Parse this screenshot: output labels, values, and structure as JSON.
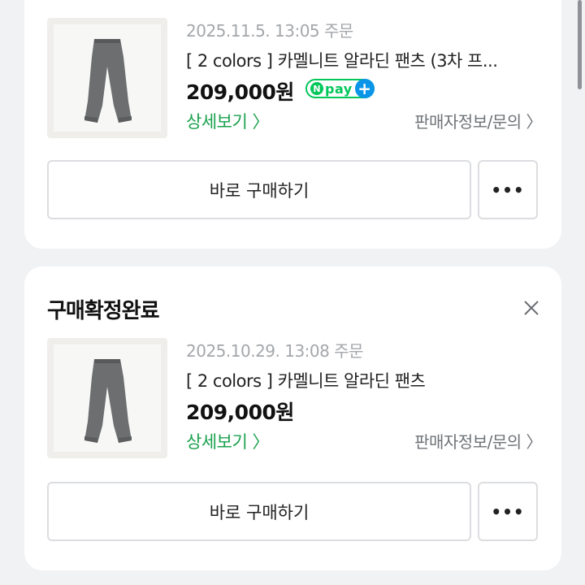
{
  "orders": [
    {
      "date": "2025.11.5. 13:05 주문",
      "product_name": "[ 2 colors ] 카멜니트 알라딘 팬츠 (3차 프...",
      "price": "209,000원",
      "npay": {
        "n": "N",
        "pay": "pay",
        "plus": "+"
      },
      "detail_link": "상세보기 〉",
      "seller_link": "판매자정보/문의 〉",
      "buy_button": "바로 구매하기",
      "more_button": "•••"
    },
    {
      "status": "구매확정완료",
      "date": "2025.10.29. 13:08 주문",
      "product_name": "[ 2 colors ] 카멜니트 알라딘 팬츠",
      "price": "209,000원",
      "detail_link": "상세보기 〉",
      "seller_link": "판매자정보/문의 〉",
      "buy_button": "바로 구매하기",
      "more_button": "•••"
    }
  ],
  "colors": {
    "accent_green": "#1aa14d",
    "npay_green": "#03c75a",
    "npay_blue": "#0b95e8"
  },
  "icons": [
    "close-icon",
    "pants-thumbnail",
    "more-dots-icon"
  ]
}
